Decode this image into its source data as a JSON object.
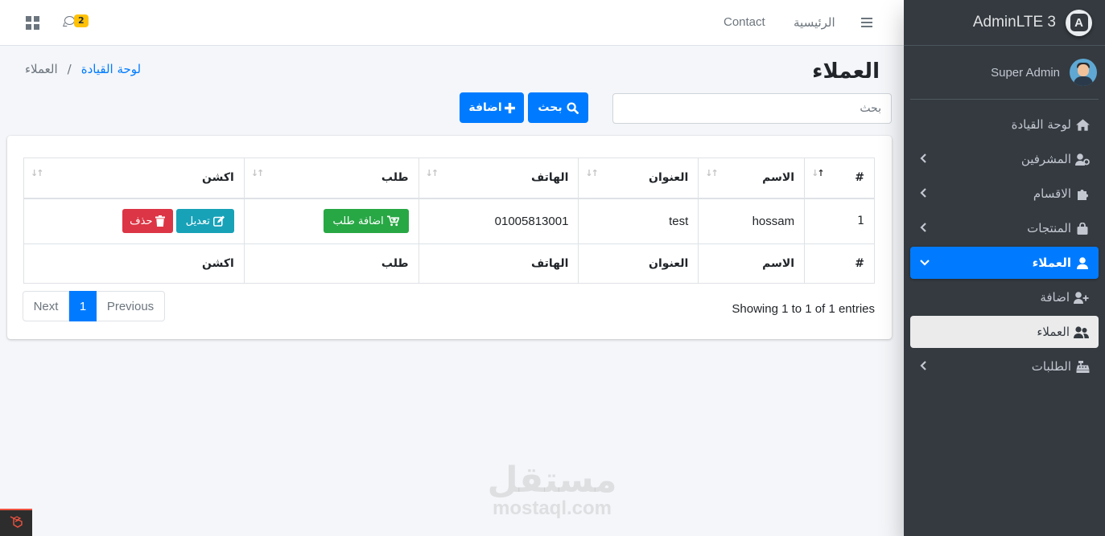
{
  "topbar": {
    "contact_label": "Contact",
    "home_label": "الرئيسية",
    "chat_badge": "2"
  },
  "sidebar": {
    "brand": "AdminLTE 3",
    "brand_logo_letter": "A",
    "user_name": "Super Admin",
    "items": [
      {
        "label": "لوحة القيادة",
        "icon": "home-icon"
      },
      {
        "label": "المشرفين",
        "icon": "user-cog-icon"
      },
      {
        "label": "الاقسام",
        "icon": "puzzle-icon"
      },
      {
        "label": "المنتجات",
        "icon": "bag-icon"
      },
      {
        "label": "العملاء",
        "icon": "user-icon"
      },
      {
        "label": "اضافة",
        "icon": "user-plus-icon"
      },
      {
        "label": "العملاء",
        "icon": "users-icon"
      },
      {
        "label": "الطلبات",
        "icon": "cash-register-icon"
      }
    ]
  },
  "page": {
    "title": "العملاء",
    "breadcrumb_link": "لوحة القيادة",
    "breadcrumb_separator": "/",
    "breadcrumb_current": "العملاء"
  },
  "search": {
    "placeholder": "بحث",
    "search_label": "بحث",
    "add_label": "اضافة"
  },
  "table": {
    "headers": [
      "#",
      "الاسم",
      "العنوان",
      "الهاتف",
      "طلب",
      "اكشن"
    ],
    "rows": [
      {
        "num": "1",
        "name": "hossam",
        "address": "test",
        "phone": "01005813001",
        "order_label": "اضافة طلب",
        "edit_label": "تعديل",
        "delete_label": "حذف"
      }
    ],
    "footers": [
      "#",
      "الاسم",
      "العنوان",
      "الهاتف",
      "طلب",
      "اكشن"
    ]
  },
  "pagination": {
    "info": "Showing 1 to 1 of 1 entries",
    "previous": "Previous",
    "current": "1",
    "next": "Next"
  },
  "watermark": {
    "arabic": "مستقل",
    "latin": "mostaql.com"
  },
  "colors": {
    "sidebar_bg": "#343a40",
    "primary": "#007bff",
    "success": "#28a745",
    "info": "#17a2b8",
    "danger": "#dc3545",
    "badge_warning": "#ffc107"
  }
}
